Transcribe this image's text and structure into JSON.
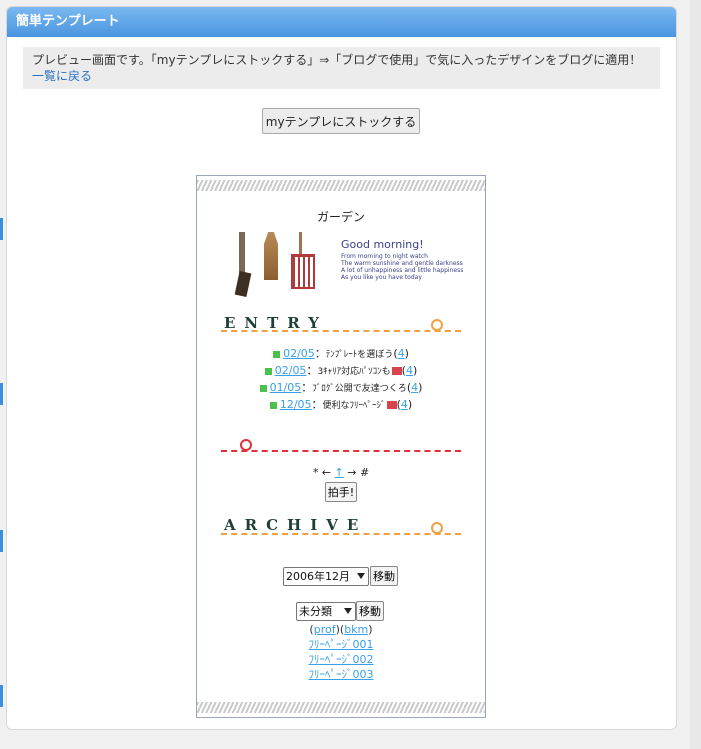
{
  "header": {
    "title": "簡単テンプレート"
  },
  "notice": {
    "text": "プレビュー画面です。「myテンプレにストックする」⇒「ブログで使用」で気に入ったデザインをブログに適用！",
    "back_link": "一覧に戻る"
  },
  "stock_button": "myテンプレにストックする",
  "blog": {
    "title": "ガーデン",
    "greeting": {
      "title": "Good morning!",
      "lines": [
        "From morning to night watch",
        "The warm sunshine and gentle darkness",
        "A lot of unhappiness and little happiness",
        "As you like you have today"
      ]
    },
    "entry_heading": "ENTRY",
    "entries": [
      {
        "date": "02/05",
        "title": "ﾃﾝﾌﾟﾚｰﾄを選ぼう",
        "count": "4"
      },
      {
        "date": "02/05",
        "title": "3ｷｬﾘｱ対応ﾊﾟｿｺﾝも",
        "count": "4"
      },
      {
        "date": "01/05",
        "title": "ﾌﾞﾛｸﾞ公開で友達つくろ",
        "count": "4"
      },
      {
        "date": "12/05",
        "title": "便利なﾌﾘｰﾍﾟｰｼﾞ",
        "count": "4"
      }
    ],
    "nav": {
      "prev": "* ←",
      "up": "↑",
      "next": "→ #"
    },
    "clap_button": "拍手!",
    "archive_heading": "ARCHIVE",
    "month_select": "2006年12月",
    "category_select": "未分類",
    "move_button": "移動",
    "links": {
      "open": "(",
      "prof": "prof",
      "mid": ")(",
      "bkm": "bkm",
      "close": ")"
    },
    "free_pages": [
      "ﾌﾘｰﾍﾟｰｼﾞ001",
      "ﾌﾘｰﾍﾟｰｼﾞ002",
      "ﾌﾘｰﾍﾟｰｼﾞ003"
    ]
  },
  "colors": {
    "header_blue": "#4a95e0",
    "link": "#3aa0e8",
    "entry_dash": "#f0a040",
    "red_dash": "#e0303a"
  }
}
